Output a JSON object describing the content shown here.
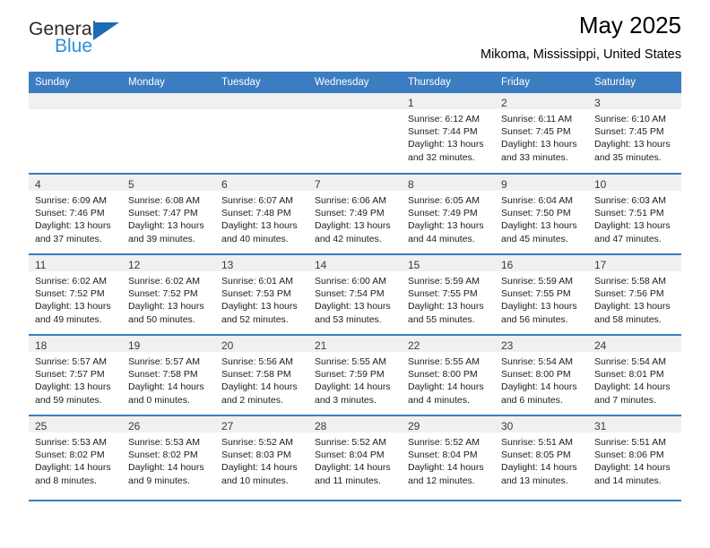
{
  "brand": {
    "name_top": "General",
    "name_bottom": "Blue",
    "triangle_color": "#1b6cb5",
    "blue_color": "#2f8fd8"
  },
  "header": {
    "title": "May 2025",
    "subtitle": "Mikoma, Mississippi, United States"
  },
  "theme": {
    "header_blue": "#3b7dc0",
    "daystrip_gray": "#f0f0f0"
  },
  "weekdays": [
    "Sunday",
    "Monday",
    "Tuesday",
    "Wednesday",
    "Thursday",
    "Friday",
    "Saturday"
  ],
  "weeks": [
    [
      {
        "day": "",
        "lines": []
      },
      {
        "day": "",
        "lines": []
      },
      {
        "day": "",
        "lines": []
      },
      {
        "day": "",
        "lines": []
      },
      {
        "day": "1",
        "lines": [
          "Sunrise: 6:12 AM",
          "Sunset: 7:44 PM",
          "Daylight: 13 hours",
          "and 32 minutes."
        ]
      },
      {
        "day": "2",
        "lines": [
          "Sunrise: 6:11 AM",
          "Sunset: 7:45 PM",
          "Daylight: 13 hours",
          "and 33 minutes."
        ]
      },
      {
        "day": "3",
        "lines": [
          "Sunrise: 6:10 AM",
          "Sunset: 7:45 PM",
          "Daylight: 13 hours",
          "and 35 minutes."
        ]
      }
    ],
    [
      {
        "day": "4",
        "lines": [
          "Sunrise: 6:09 AM",
          "Sunset: 7:46 PM",
          "Daylight: 13 hours",
          "and 37 minutes."
        ]
      },
      {
        "day": "5",
        "lines": [
          "Sunrise: 6:08 AM",
          "Sunset: 7:47 PM",
          "Daylight: 13 hours",
          "and 39 minutes."
        ]
      },
      {
        "day": "6",
        "lines": [
          "Sunrise: 6:07 AM",
          "Sunset: 7:48 PM",
          "Daylight: 13 hours",
          "and 40 minutes."
        ]
      },
      {
        "day": "7",
        "lines": [
          "Sunrise: 6:06 AM",
          "Sunset: 7:49 PM",
          "Daylight: 13 hours",
          "and 42 minutes."
        ]
      },
      {
        "day": "8",
        "lines": [
          "Sunrise: 6:05 AM",
          "Sunset: 7:49 PM",
          "Daylight: 13 hours",
          "and 44 minutes."
        ]
      },
      {
        "day": "9",
        "lines": [
          "Sunrise: 6:04 AM",
          "Sunset: 7:50 PM",
          "Daylight: 13 hours",
          "and 45 minutes."
        ]
      },
      {
        "day": "10",
        "lines": [
          "Sunrise: 6:03 AM",
          "Sunset: 7:51 PM",
          "Daylight: 13 hours",
          "and 47 minutes."
        ]
      }
    ],
    [
      {
        "day": "11",
        "lines": [
          "Sunrise: 6:02 AM",
          "Sunset: 7:52 PM",
          "Daylight: 13 hours",
          "and 49 minutes."
        ]
      },
      {
        "day": "12",
        "lines": [
          "Sunrise: 6:02 AM",
          "Sunset: 7:52 PM",
          "Daylight: 13 hours",
          "and 50 minutes."
        ]
      },
      {
        "day": "13",
        "lines": [
          "Sunrise: 6:01 AM",
          "Sunset: 7:53 PM",
          "Daylight: 13 hours",
          "and 52 minutes."
        ]
      },
      {
        "day": "14",
        "lines": [
          "Sunrise: 6:00 AM",
          "Sunset: 7:54 PM",
          "Daylight: 13 hours",
          "and 53 minutes."
        ]
      },
      {
        "day": "15",
        "lines": [
          "Sunrise: 5:59 AM",
          "Sunset: 7:55 PM",
          "Daylight: 13 hours",
          "and 55 minutes."
        ]
      },
      {
        "day": "16",
        "lines": [
          "Sunrise: 5:59 AM",
          "Sunset: 7:55 PM",
          "Daylight: 13 hours",
          "and 56 minutes."
        ]
      },
      {
        "day": "17",
        "lines": [
          "Sunrise: 5:58 AM",
          "Sunset: 7:56 PM",
          "Daylight: 13 hours",
          "and 58 minutes."
        ]
      }
    ],
    [
      {
        "day": "18",
        "lines": [
          "Sunrise: 5:57 AM",
          "Sunset: 7:57 PM",
          "Daylight: 13 hours",
          "and 59 minutes."
        ]
      },
      {
        "day": "19",
        "lines": [
          "Sunrise: 5:57 AM",
          "Sunset: 7:58 PM",
          "Daylight: 14 hours",
          "and 0 minutes."
        ]
      },
      {
        "day": "20",
        "lines": [
          "Sunrise: 5:56 AM",
          "Sunset: 7:58 PM",
          "Daylight: 14 hours",
          "and 2 minutes."
        ]
      },
      {
        "day": "21",
        "lines": [
          "Sunrise: 5:55 AM",
          "Sunset: 7:59 PM",
          "Daylight: 14 hours",
          "and 3 minutes."
        ]
      },
      {
        "day": "22",
        "lines": [
          "Sunrise: 5:55 AM",
          "Sunset: 8:00 PM",
          "Daylight: 14 hours",
          "and 4 minutes."
        ]
      },
      {
        "day": "23",
        "lines": [
          "Sunrise: 5:54 AM",
          "Sunset: 8:00 PM",
          "Daylight: 14 hours",
          "and 6 minutes."
        ]
      },
      {
        "day": "24",
        "lines": [
          "Sunrise: 5:54 AM",
          "Sunset: 8:01 PM",
          "Daylight: 14 hours",
          "and 7 minutes."
        ]
      }
    ],
    [
      {
        "day": "25",
        "lines": [
          "Sunrise: 5:53 AM",
          "Sunset: 8:02 PM",
          "Daylight: 14 hours",
          "and 8 minutes."
        ]
      },
      {
        "day": "26",
        "lines": [
          "Sunrise: 5:53 AM",
          "Sunset: 8:02 PM",
          "Daylight: 14 hours",
          "and 9 minutes."
        ]
      },
      {
        "day": "27",
        "lines": [
          "Sunrise: 5:52 AM",
          "Sunset: 8:03 PM",
          "Daylight: 14 hours",
          "and 10 minutes."
        ]
      },
      {
        "day": "28",
        "lines": [
          "Sunrise: 5:52 AM",
          "Sunset: 8:04 PM",
          "Daylight: 14 hours",
          "and 11 minutes."
        ]
      },
      {
        "day": "29",
        "lines": [
          "Sunrise: 5:52 AM",
          "Sunset: 8:04 PM",
          "Daylight: 14 hours",
          "and 12 minutes."
        ]
      },
      {
        "day": "30",
        "lines": [
          "Sunrise: 5:51 AM",
          "Sunset: 8:05 PM",
          "Daylight: 14 hours",
          "and 13 minutes."
        ]
      },
      {
        "day": "31",
        "lines": [
          "Sunrise: 5:51 AM",
          "Sunset: 8:06 PM",
          "Daylight: 14 hours",
          "and 14 minutes."
        ]
      }
    ]
  ]
}
